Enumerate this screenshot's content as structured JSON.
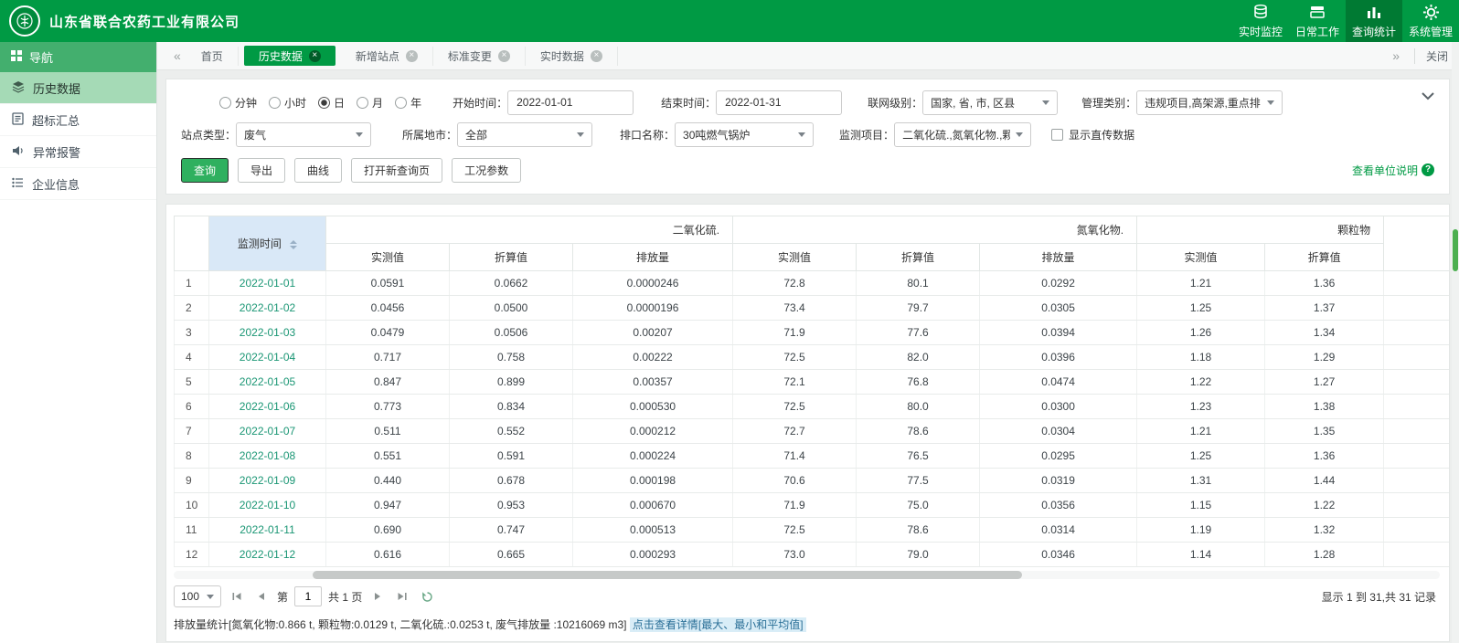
{
  "header": {
    "company": "山东省联合农药工业有限公司",
    "nav": [
      {
        "label": "实时监控"
      },
      {
        "label": "日常工作"
      },
      {
        "label": "查询统计"
      },
      {
        "label": "系统管理"
      }
    ]
  },
  "sidebar": {
    "title": "导航",
    "items": [
      {
        "label": "历史数据"
      },
      {
        "label": "超标汇总"
      },
      {
        "label": "异常报警"
      },
      {
        "label": "企业信息"
      }
    ]
  },
  "tabbar": {
    "tabs": [
      {
        "label": "首页"
      },
      {
        "label": "历史数据"
      },
      {
        "label": "新增站点"
      },
      {
        "label": "标准变更"
      },
      {
        "label": "实时数据"
      }
    ],
    "close_all": "关闭"
  },
  "filters": {
    "periods": [
      "分钟",
      "小时",
      "日",
      "月",
      "年"
    ],
    "period_selected": "日",
    "labels": {
      "start": "开始时间：",
      "end": "结束时间：",
      "network": "联网级别：",
      "manage": "管理类别：",
      "station": "站点类型：",
      "city": "所属地市：",
      "outlet": "排口名称：",
      "item": "监测项目："
    },
    "values": {
      "start": "2022-01-01",
      "end": "2022-01-31",
      "network": "国家, 省, 市, 区县",
      "manage": "违规项目,高架源,重点排",
      "station": "废气",
      "city": "全部",
      "outlet": "30吨燃气锅炉",
      "item": "二氧化硫.,氮氧化物.,颗粒"
    },
    "direct_data_checkbox": "显示直传数据",
    "buttons": [
      "查询",
      "导出",
      "曲线",
      "打开新查询页",
      "工况参数"
    ],
    "unit_link": "查看单位说明"
  },
  "table": {
    "time_header": "监测时间",
    "groups": [
      "二氧化硫.",
      "氮氧化物.",
      "颗粒物"
    ],
    "sub_headers": [
      "实测值",
      "折算值",
      "排放量"
    ],
    "rows": [
      {
        "index": "1",
        "date": "2022-01-01",
        "values": [
          "0.0591",
          "0.0662",
          "0.0000246",
          "72.8",
          "80.1",
          "0.0292",
          "1.21",
          "1.36"
        ]
      },
      {
        "index": "2",
        "date": "2022-01-02",
        "values": [
          "0.0456",
          "0.0500",
          "0.0000196",
          "73.4",
          "79.7",
          "0.0305",
          "1.25",
          "1.37"
        ]
      },
      {
        "index": "3",
        "date": "2022-01-03",
        "values": [
          "0.0479",
          "0.0506",
          "0.00207",
          "71.9",
          "77.6",
          "0.0394",
          "1.26",
          "1.34"
        ]
      },
      {
        "index": "4",
        "date": "2022-01-04",
        "values": [
          "0.717",
          "0.758",
          "0.00222",
          "72.5",
          "82.0",
          "0.0396",
          "1.18",
          "1.29"
        ]
      },
      {
        "index": "5",
        "date": "2022-01-05",
        "values": [
          "0.847",
          "0.899",
          "0.00357",
          "72.1",
          "76.8",
          "0.0474",
          "1.22",
          "1.27"
        ]
      },
      {
        "index": "6",
        "date": "2022-01-06",
        "values": [
          "0.773",
          "0.834",
          "0.000530",
          "72.5",
          "80.0",
          "0.0300",
          "1.23",
          "1.38"
        ]
      },
      {
        "index": "7",
        "date": "2022-01-07",
        "values": [
          "0.511",
          "0.552",
          "0.000212",
          "72.7",
          "78.6",
          "0.0304",
          "1.21",
          "1.35"
        ]
      },
      {
        "index": "8",
        "date": "2022-01-08",
        "values": [
          "0.551",
          "0.591",
          "0.000224",
          "71.4",
          "76.5",
          "0.0295",
          "1.25",
          "1.36"
        ]
      },
      {
        "index": "9",
        "date": "2022-01-09",
        "values": [
          "0.440",
          "0.678",
          "0.000198",
          "70.6",
          "77.5",
          "0.0319",
          "1.31",
          "1.44"
        ]
      },
      {
        "index": "10",
        "date": "2022-01-10",
        "values": [
          "0.947",
          "0.953",
          "0.000670",
          "71.9",
          "75.0",
          "0.0356",
          "1.15",
          "1.22"
        ]
      },
      {
        "index": "11",
        "date": "2022-01-11",
        "values": [
          "0.690",
          "0.747",
          "0.000513",
          "72.5",
          "78.6",
          "0.0314",
          "1.19",
          "1.32"
        ]
      },
      {
        "index": "12",
        "date": "2022-01-12",
        "values": [
          "0.616",
          "0.665",
          "0.000293",
          "73.0",
          "79.0",
          "0.0346",
          "1.14",
          "1.28"
        ]
      }
    ]
  },
  "pagination": {
    "page_size": "100",
    "page_prefix": "第",
    "page_value": "1",
    "page_suffix": "共 1 页",
    "info": "显示 1 到 31,共 31 记录"
  },
  "summary": {
    "stats": "排放量统计[氮氧化物:0.866 t, 颗粒物:0.0129 t, 二氧化硫.:0.0253 t, 废气排放量 :10216069 m3]",
    "detail_link": "点击查看详情[最大、最小和平均值]"
  },
  "colors": {
    "brand_green": "#009a44",
    "active_nav_green": "#007a33",
    "sidebar_selected": "#a5dab6",
    "link_green": "#1a9674",
    "time_header_bg": "#d9e8f7"
  }
}
